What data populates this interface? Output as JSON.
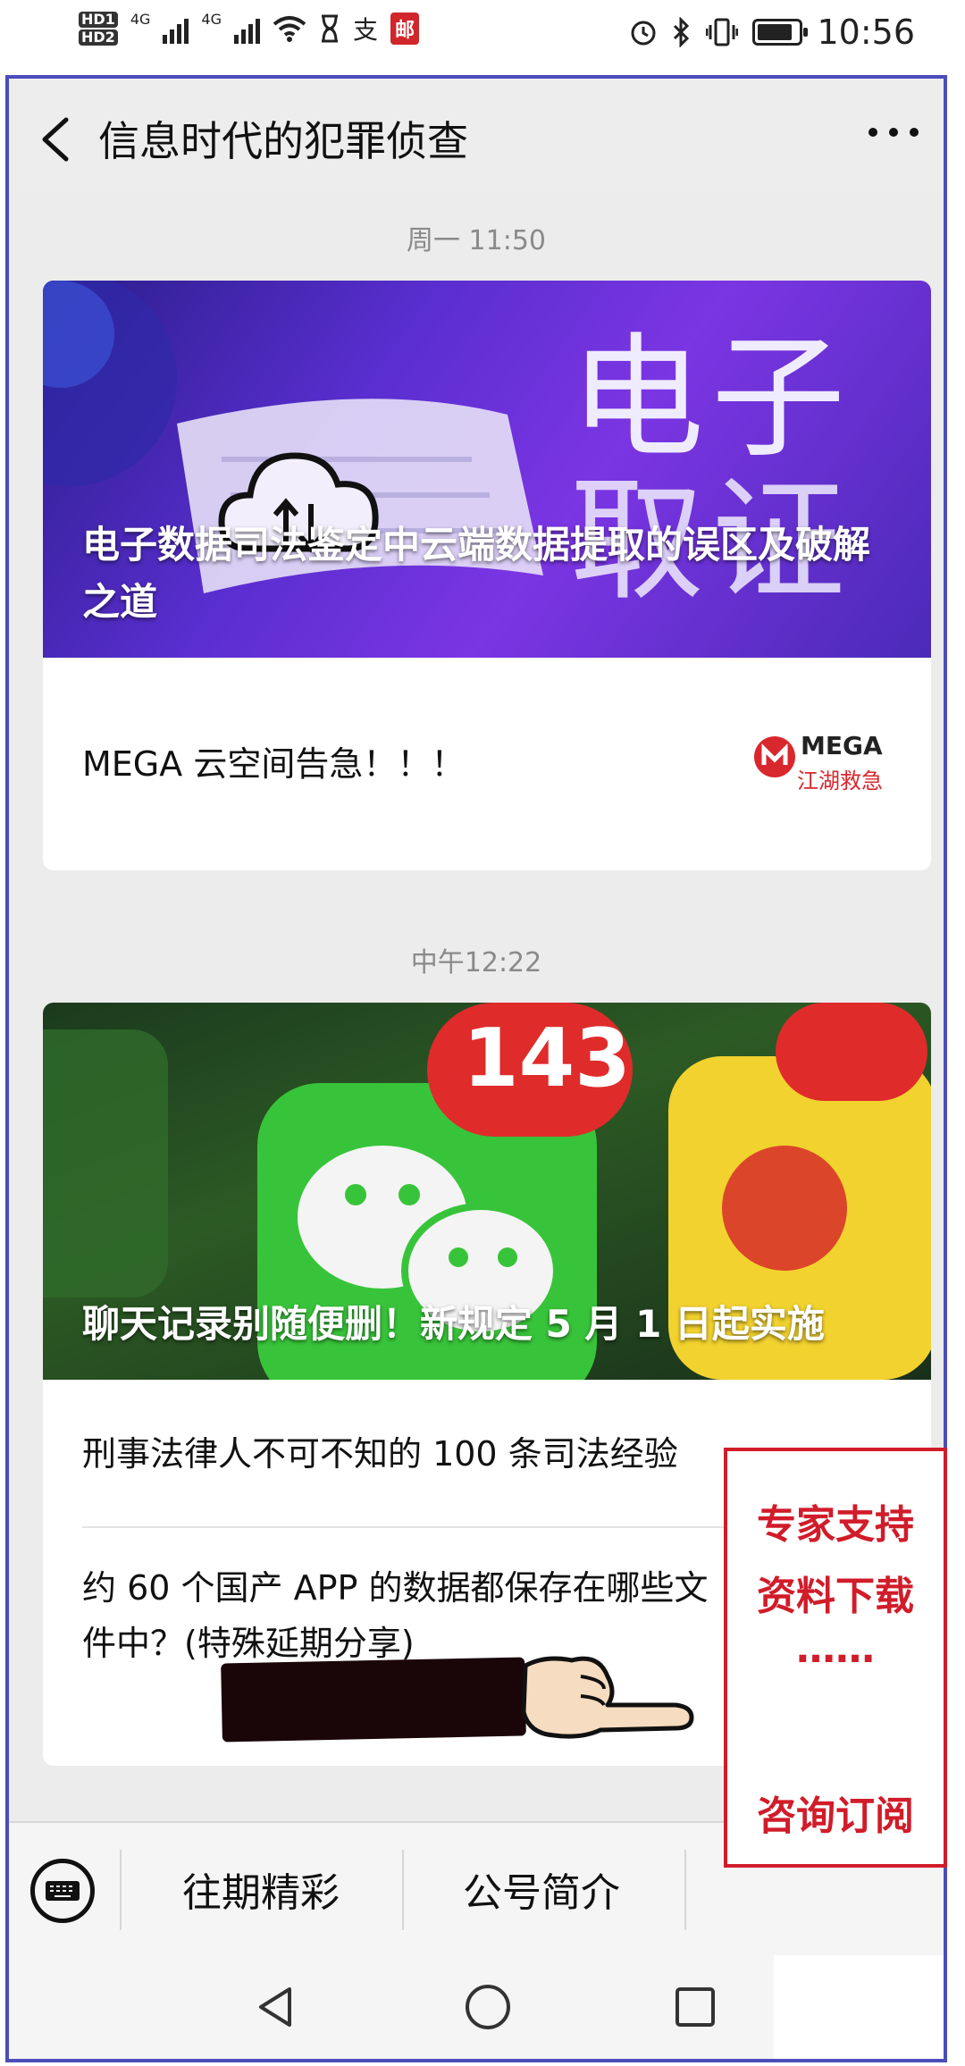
{
  "status_bar": {
    "hd_top": "HD1",
    "hd_bottom": "HD2",
    "net1": "4G",
    "net2": "4G",
    "app_badge": "邮",
    "pay_glyph": "支",
    "time": "10:56",
    "battery_level": 0.85
  },
  "header": {
    "title": "信息时代的犯罪侦查"
  },
  "messages": [
    {
      "timestamp": "周一 11:50",
      "cover_title": "电子数据司法鉴定中云端数据提取的误区及破解之道",
      "cover_art_text_1": "电子",
      "cover_art_text_2": "取证",
      "items": [
        {
          "title": "MEGA 云空间告急！！！",
          "thumb_brand": "MEGA",
          "thumb_caption": "江湖救急"
        }
      ]
    },
    {
      "timestamp": "中午12:22",
      "cover_title": "聊天记录别随便删！新规定 5 月 1 日起实施",
      "cover_badge": "143",
      "items": [
        {
          "title": "刑事法律人不可不知的 100 条司法经验"
        },
        {
          "title_line1": "约 60 个国产 APP 的数据都保存在哪些文",
          "title_line2": "件中？(特殊延期分享)"
        }
      ]
    }
  ],
  "bottom_menu": {
    "item1": "往期精彩",
    "item2": "公号简介",
    "item3": "咨询订阅"
  },
  "promo": {
    "line1": "专家支持",
    "line2": "资料下载",
    "line3": "……",
    "line4": "咨询订阅"
  },
  "colors": {
    "frame_border": "#4b4dba",
    "promo_red": "#d11c2a",
    "chat_bg": "#ececec"
  }
}
